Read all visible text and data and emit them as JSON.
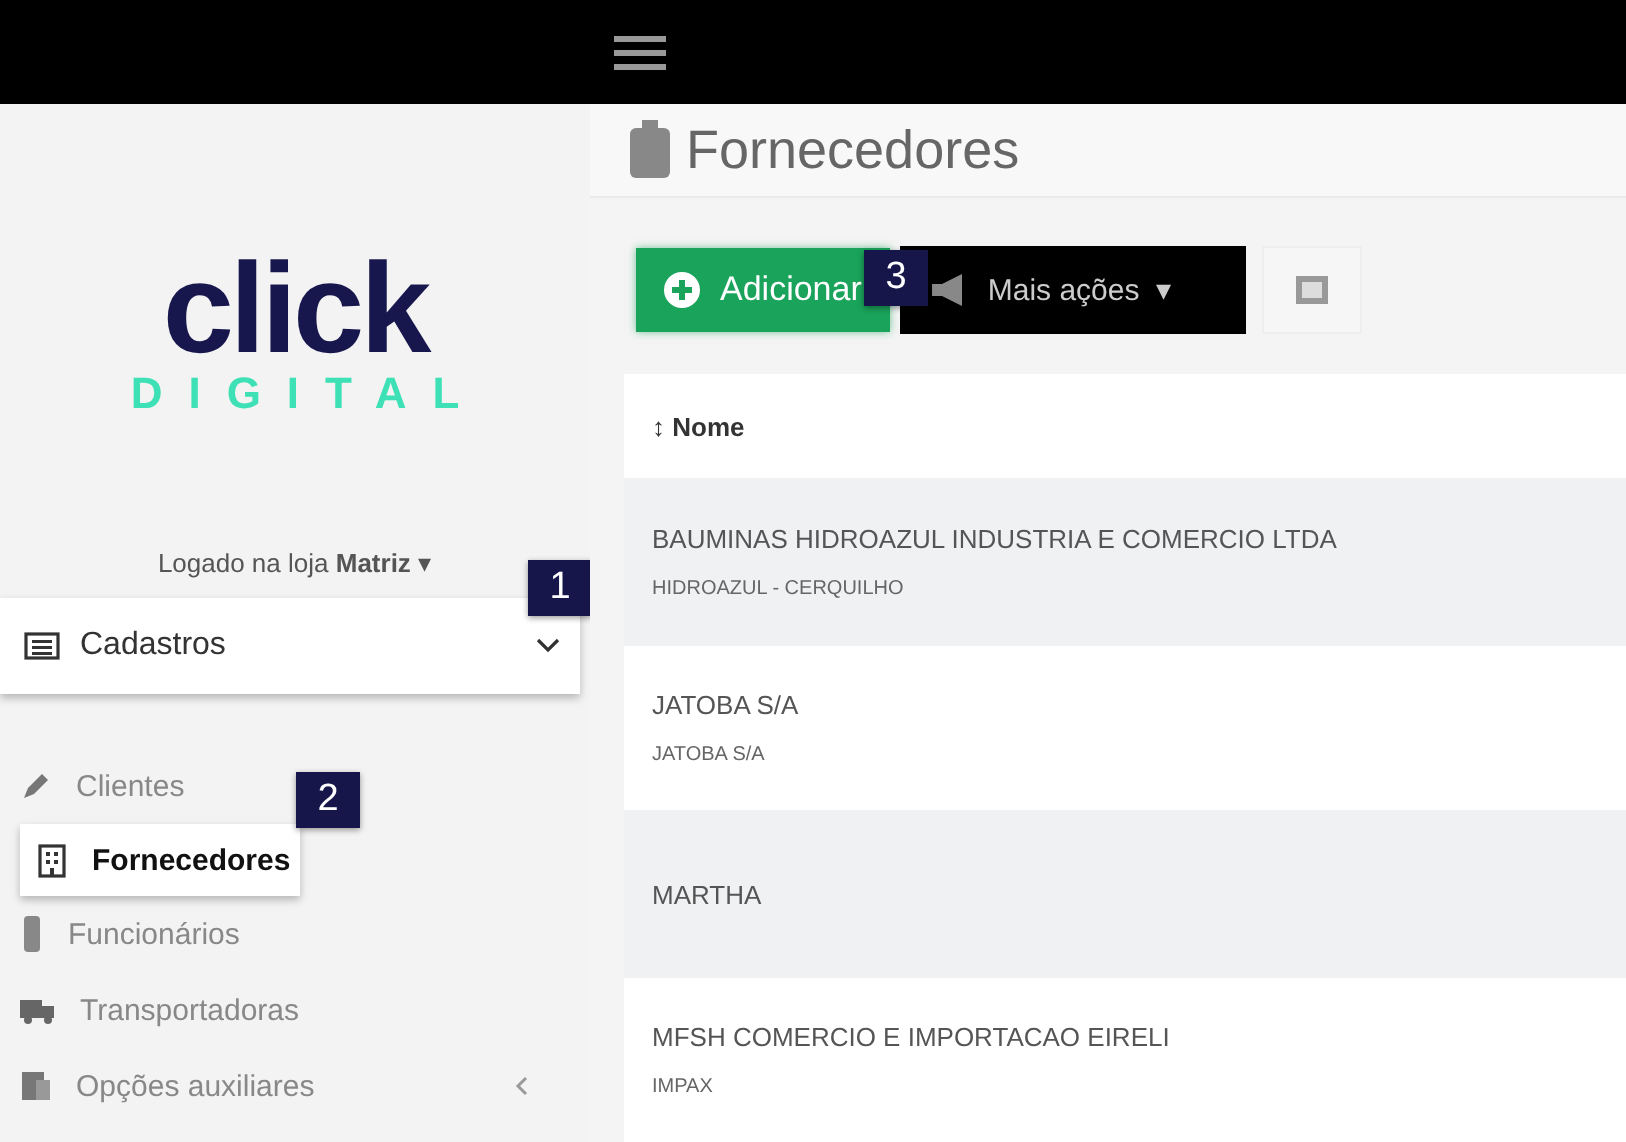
{
  "sidebar": {
    "logo": {
      "word": "click",
      "tagline": "DIGITAL"
    },
    "store": {
      "label": "Logado na loja",
      "name": "Matriz",
      "caret": "▾"
    },
    "section": {
      "label": "Cadastros",
      "expanded": true
    },
    "items": [
      {
        "label": "Clientes",
        "kind": "link",
        "selected": false
      },
      {
        "label": "Fornecedores",
        "kind": "link",
        "selected": true
      },
      {
        "label": "Funcionários",
        "kind": "link",
        "selected": false
      },
      {
        "label": "Transportadoras",
        "kind": "link",
        "selected": false
      },
      {
        "label": "Opções auxiliares",
        "kind": "submenu",
        "selected": false
      }
    ]
  },
  "page": {
    "title": "Fornecedores",
    "toolbar": {
      "add": "Adicionar",
      "more": "Mais ações",
      "more_caret": "▾"
    },
    "table": {
      "column": "Nome",
      "sort": "↕",
      "rows": [
        {
          "name": "BAUMINAS HIDROAZUL INDUSTRIA E COMERCIO LTDA",
          "detail": "HIDROAZUL - CERQUILHO"
        },
        {
          "name": "JATOBA S/A",
          "detail": "JATOBA S/A"
        },
        {
          "name": "MARTHA"
        },
        {
          "name": "MFSH COMERCIO E IMPORTACAO EIRELI",
          "detail": "IMPAX"
        }
      ]
    }
  },
  "callouts": [
    "1",
    "2",
    "3"
  ]
}
